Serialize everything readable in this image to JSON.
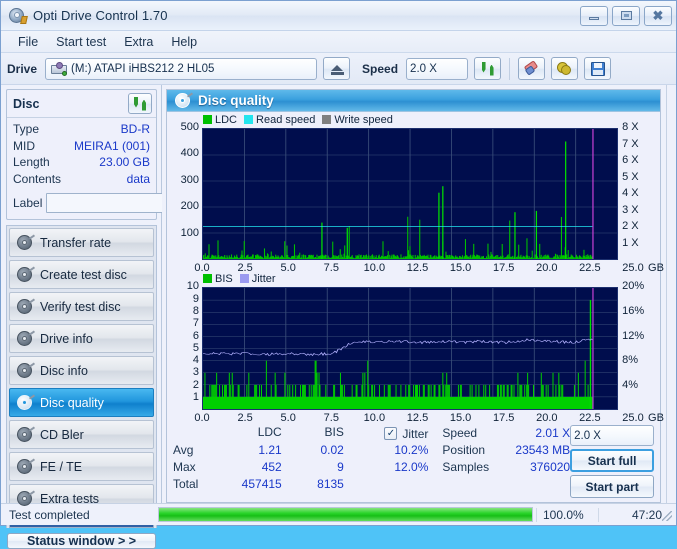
{
  "window": {
    "title": "Opti Drive Control 1.70",
    "icon": "disc-drive-icon",
    "buttons": {
      "minimize": "minimize",
      "maximize": "maximize",
      "close": "close"
    }
  },
  "menubar": {
    "items": [
      "File",
      "Start test",
      "Extra",
      "Help"
    ]
  },
  "toolbar": {
    "drive_label": "Drive",
    "drive_value": "(M:)  ATAPI iHBS212  2 HL05",
    "eject_icon": "eject-icon",
    "speed_label": "Speed",
    "speed_value": "2.0 X",
    "refresh_icon": "swap-arrows-icon",
    "eraser_icon": "eraser-icon",
    "gear_icon": "gear-icon",
    "save_icon": "floppy-save-icon"
  },
  "disc_panel": {
    "title": "Disc",
    "refresh_icon": "swap-arrows-icon",
    "rows": [
      {
        "key": "Type",
        "value": "BD-R"
      },
      {
        "key": "MID",
        "value": "MEIRA1 (001)"
      },
      {
        "key": "Length",
        "value": "23.00 GB"
      },
      {
        "key": "Contents",
        "value": "data"
      }
    ],
    "label_key": "Label",
    "label_value": "",
    "label_placeholder": "",
    "label_icon": "cd-disc-icon"
  },
  "sidebar": {
    "items": [
      {
        "label": "Transfer rate",
        "icon": "disc-icon",
        "active": false
      },
      {
        "label": "Create test disc",
        "icon": "disc-icon",
        "active": false
      },
      {
        "label": "Verify test disc",
        "icon": "disc-icon",
        "active": false
      },
      {
        "label": "Drive info",
        "icon": "disc-icon",
        "active": false
      },
      {
        "label": "Disc info",
        "icon": "disc-icon",
        "active": false
      },
      {
        "label": "Disc quality",
        "icon": "disc-icon",
        "active": true
      },
      {
        "label": "CD Bler",
        "icon": "disc-icon",
        "active": false
      },
      {
        "label": "FE / TE",
        "icon": "disc-icon",
        "active": false
      },
      {
        "label": "Extra tests",
        "icon": "disc-icon",
        "active": false
      }
    ],
    "status_button": "Status window > >"
  },
  "main": {
    "header_title": "Disc quality",
    "header_icon": "disc-icon"
  },
  "chart_data": [
    {
      "type": "line",
      "name": "ldc-chart",
      "title": "",
      "xlabel": "GB",
      "ylabel": "",
      "legend": [
        {
          "label": "LDC",
          "color": "#00c000"
        },
        {
          "label": "Read speed",
          "color": "#22e5ee"
        },
        {
          "label": "Write speed",
          "color": "#808080"
        }
      ],
      "legend_position": "top-left",
      "grid": true,
      "xlim": [
        0,
        25
      ],
      "xticks": [
        "0.0",
        "2.5",
        "5.0",
        "7.5",
        "10.0",
        "12.5",
        "15.0",
        "17.5",
        "20.0",
        "22.5",
        "25.0"
      ],
      "xunit": "GB",
      "ylim": [
        0,
        500
      ],
      "yticks": [
        "100",
        "200",
        "300",
        "400",
        "500"
      ],
      "y2lim": [
        0,
        8
      ],
      "y2ticks": [
        "1 X",
        "2 X",
        "3 X",
        "4 X",
        "5 X",
        "6 X",
        "7 X",
        "8 X"
      ],
      "series": [
        {
          "name": "LDC",
          "color": "#00c000",
          "avg": 1.21,
          "max": 452,
          "total": 457415
        },
        {
          "name": "Read speed",
          "color": "#22e5ee",
          "constant_x": 2.01
        }
      ],
      "end_marker_gb": 23.543
    },
    {
      "type": "line",
      "name": "bis-jitter-chart",
      "title": "",
      "xlabel": "GB",
      "legend": [
        {
          "label": "BIS",
          "color": "#00c000"
        },
        {
          "label": "Jitter",
          "color": "#9a9af0"
        }
      ],
      "legend_position": "top-left",
      "grid": true,
      "xlim": [
        0,
        25
      ],
      "xticks": [
        "0.0",
        "2.5",
        "5.0",
        "7.5",
        "10.0",
        "12.5",
        "15.0",
        "17.5",
        "20.0",
        "22.5",
        "25.0"
      ],
      "xunit": "GB",
      "ylim": [
        0,
        10
      ],
      "yticks": [
        "1",
        "2",
        "3",
        "4",
        "5",
        "6",
        "7",
        "8",
        "9",
        "10"
      ],
      "y2lim": [
        0,
        20
      ],
      "y2ticks": [
        "4%",
        "8%",
        "12%",
        "16%",
        "20%"
      ],
      "series": [
        {
          "name": "BIS",
          "color": "#00c000",
          "avg": 0.02,
          "max": 9,
          "total": 8135
        },
        {
          "name": "Jitter",
          "color": "#9a9af0",
          "avg_pct": 10.2,
          "max_pct": 12.0,
          "profile": [
            4.6,
            4.55,
            4.6,
            4.5,
            4.6,
            4.5,
            4.6,
            5.6,
            5.5,
            5.6,
            5.5,
            5.6,
            5.5,
            5.6,
            5.5,
            5.7,
            5.6,
            5.5,
            5.8
          ]
        }
      ],
      "end_marker_gb": 23.543
    }
  ],
  "stats": {
    "columns": [
      "",
      "LDC",
      "BIS",
      "Jitter"
    ],
    "ldc_header": "LDC",
    "bis_header": "BIS",
    "jitter_header": "Jitter",
    "jitter_checked": true,
    "jitter_check_glyph": "✓",
    "rows": [
      {
        "label": "Avg",
        "ldc": "1.21",
        "bis": "0.02",
        "jitter": "10.2%"
      },
      {
        "label": "Max",
        "ldc": "452",
        "bis": "9",
        "jitter": "12.0%"
      },
      {
        "label": "Total",
        "ldc": "457415",
        "bis": "8135",
        "jitter": ""
      }
    ],
    "speed_label": "Speed",
    "speed_value": "2.01 X",
    "position_label": "Position",
    "position_value": "23543 MB",
    "samples_label": "Samples",
    "samples_value": "376020",
    "speed_select": "2.0 X",
    "start_full": "Start full",
    "start_part": "Start part"
  },
  "statusbar": {
    "text": "Test completed",
    "progress_pct": 100,
    "progress_label": "100.0%",
    "elapsed": "47:20"
  }
}
